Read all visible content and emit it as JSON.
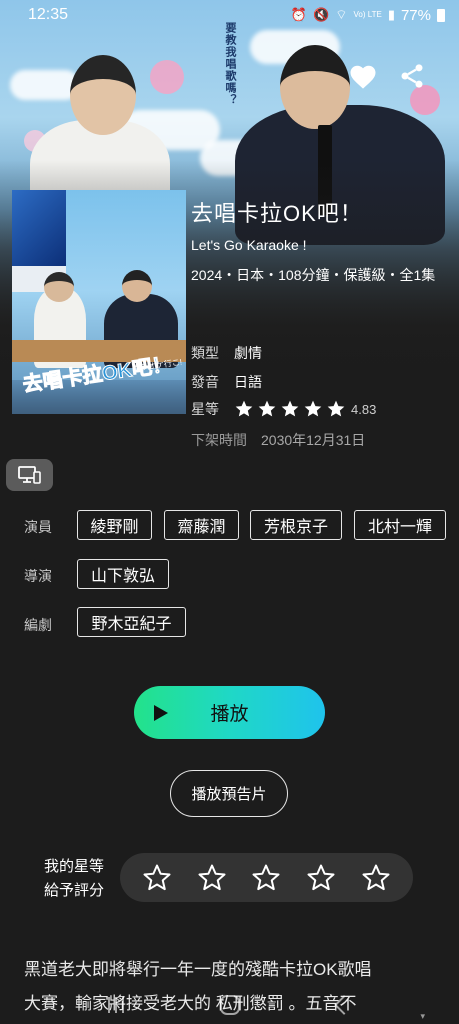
{
  "status_bar": {
    "time": "12:35",
    "battery": "77%",
    "network": "Vo) LTE"
  },
  "hero": {
    "poster_vertical_text": "要教我唱歌嗎？"
  },
  "poster": {
    "title_art": "去唱卡拉OK吧！",
    "title_art_sub": "カラオケ行こ!"
  },
  "movie": {
    "title": "去唱卡拉OK吧！",
    "subtitle": "Let's Go Karaoke !",
    "meta": "2024・日本・108分鐘・保護級・全1集",
    "genre_label": "類型",
    "genre": "劇情",
    "language_label": "發音",
    "language": "日語",
    "rating_label": "星等",
    "rating": "4.83",
    "rating_stars": 5,
    "expiry_label": "下架時間",
    "expiry": "2030年12月31日"
  },
  "credits": {
    "cast_label": "演員",
    "cast": [
      "綾野剛",
      "齋藤潤",
      "芳根京子",
      "北村一輝"
    ],
    "director_label": "導演",
    "directors": [
      "山下敦弘"
    ],
    "writer_label": "編劇",
    "writers": [
      "野木亞紀子"
    ]
  },
  "actions": {
    "play": "播放",
    "trailer": "播放預告片"
  },
  "my_rating": {
    "label_line1": "我的星等",
    "label_line2": "給予評分",
    "value": 0,
    "max": 5
  },
  "description": {
    "line1": "黑道老大即將舉行一年一度的殘酷卡拉OK歌唱",
    "line2": "大賽，輸家將接受老大的 私刑懲罰 。五音不"
  },
  "icons": [
    "heart-icon",
    "share-icon",
    "cast-device-icon",
    "play-icon",
    "star-icon"
  ],
  "colors": {
    "play_gradient_start": "#23e28a",
    "play_gradient_end": "#1fc3ec",
    "background": "#1c1c1c"
  }
}
